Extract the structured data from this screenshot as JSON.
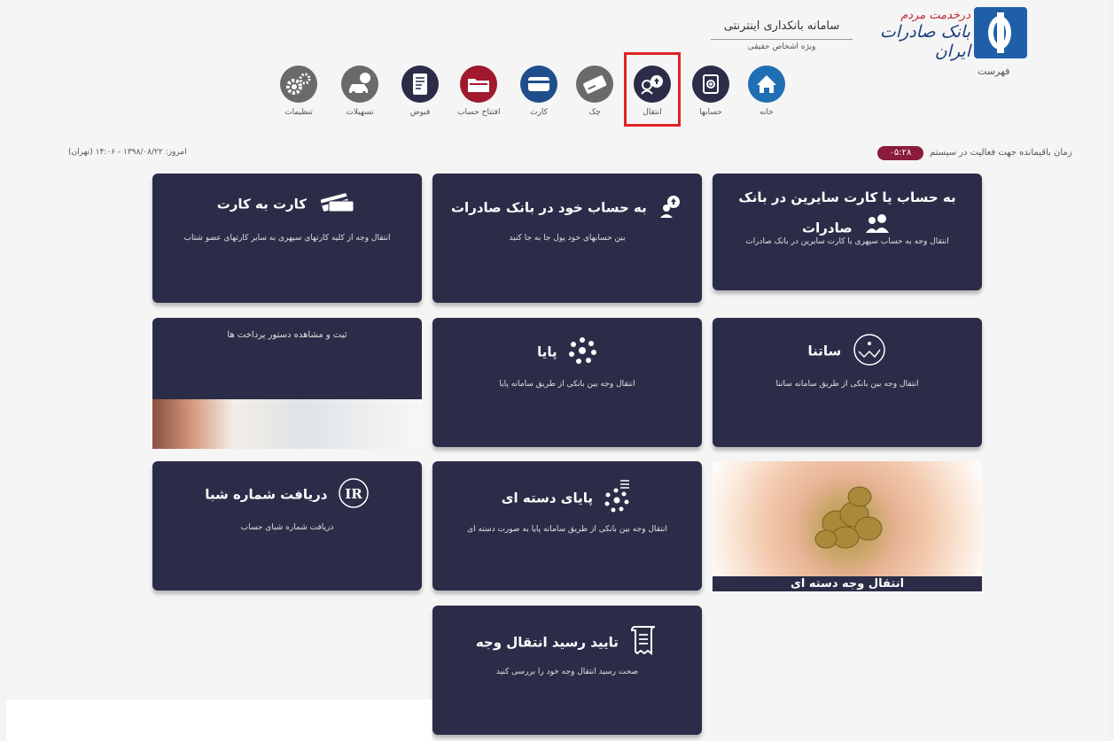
{
  "header": {
    "brand_top": "درخدمت مردم",
    "brand_name": "بانک صادرات ایران",
    "system_title": "سامانه بانکداری اینترنتی",
    "system_subtitle": "ویژه اشخاص حقیقی",
    "menu_label": "فهرست"
  },
  "nav": [
    {
      "label": "خانه",
      "icon": "home-icon",
      "color": "#1f6fb5"
    },
    {
      "label": "حسابها",
      "icon": "accounts-icon",
      "color": "#2b2d48"
    },
    {
      "label": "انتقال",
      "icon": "transfer-icon",
      "color": "#2b2d48"
    },
    {
      "label": "چک",
      "icon": "check-icon",
      "color": "#6a6a6a"
    },
    {
      "label": "کارت",
      "icon": "card-icon",
      "color": "#1f4f8a"
    },
    {
      "label": "افتتاح حساب",
      "icon": "folder-icon",
      "color": "#a0192d"
    },
    {
      "label": "قبوض",
      "icon": "bill-icon",
      "color": "#2b2d48"
    },
    {
      "label": "تسهیلات",
      "icon": "loan-icon",
      "color": "#6a6a6a"
    },
    {
      "label": "تنظیمات",
      "icon": "gear-icon",
      "color": "#6a6a6a"
    }
  ],
  "status": {
    "timer_label": "زمان باقیمانده جهت فعالیت در سیستم",
    "timer_value": "۰۵:۲۸",
    "today": "امروز: ۱۳۹۸/۰۸/۲۲ - ۱۴:۰۶ (تهران)"
  },
  "tiles": {
    "card_to_card": {
      "title": "کارت به کارت",
      "desc": "انتقال وجه از کلیه کارتهای سپهری به سایر کارتهای عضو شتاب"
    },
    "own_account": {
      "title": "به حساب خود در بانک صادرات",
      "desc": "بین حسابهای خود پول جا به جا کنید"
    },
    "others_account": {
      "title": "به حساب یا کارت سایرین در بانک صادرات",
      "desc": "انتقال وجه به حساب سپهری یا کارت سایرین در بانک صادرات"
    },
    "payment_order": {
      "title": "ثبت و مشاهده دستور پرداخت ها"
    },
    "paya": {
      "title": "پایا",
      "desc": "انتقال وجه بین بانکی از طریق سامانه پایا"
    },
    "satna": {
      "title": "ساتنا",
      "desc": "انتقال وجه بین بانکی از طریق سامانه ساتنا"
    },
    "sheba": {
      "title": "دریافت شماره شبا",
      "desc": "دریافت شماره شبای حساب",
      "logo": "IR"
    },
    "paya_batch": {
      "title": "پایای دسته ای",
      "desc": "انتقال وجه بین بانکی از طریق سامانه پایا به صورت دسته ای"
    },
    "batch_transfer": {
      "title": "انتقال وجه دسته ای"
    },
    "receipt": {
      "title": "تایید رسید انتقال وجه",
      "desc": "صحت رسید انتقال وجه خود را بررسی کنید"
    }
  }
}
